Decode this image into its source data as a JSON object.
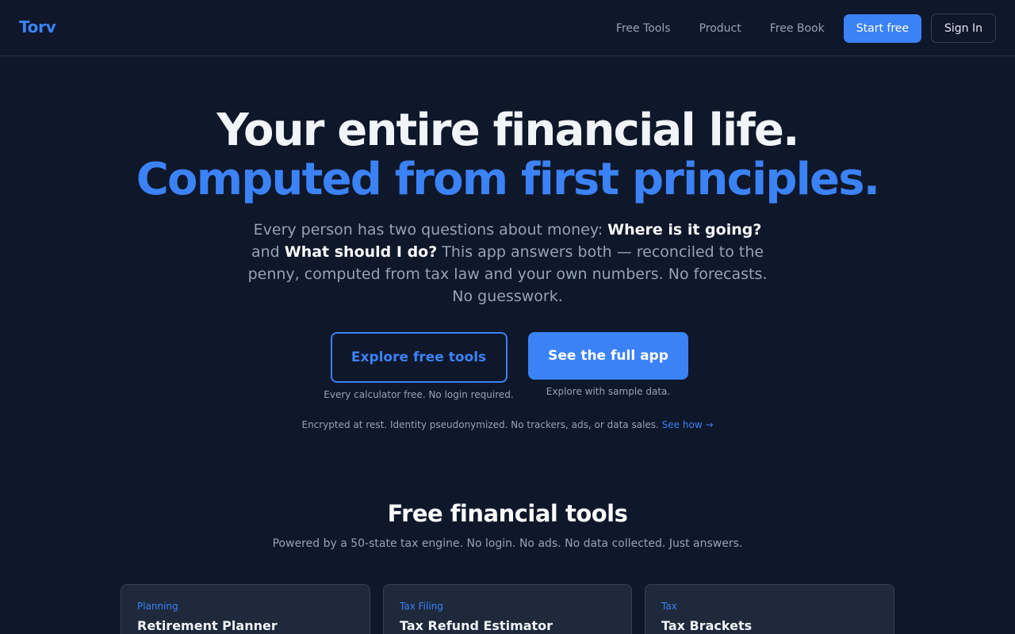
{
  "header": {
    "brand": "Torv",
    "nav": [
      "Free Tools",
      "Product",
      "Free Book"
    ],
    "start_label": "Start free",
    "signin_label": "Sign In"
  },
  "hero": {
    "title_line1": "Your entire financial life.",
    "title_line2": "Computed from first principles.",
    "sub_pre": "Every person has two questions about money: ",
    "sub_q1": "Where is it going?",
    "sub_and": " and ",
    "sub_q2": "What should I do?",
    "sub_post": " This app answers both — reconciled to the penny, computed from tax law and your own numbers. No forecasts. No guesswork.",
    "explore_label": "Explore free tools",
    "explore_note": "Every calculator free. No login required.",
    "full_label": "See the full app",
    "full_note": "Explore with sample data.",
    "privacy_text": "Encrypted at rest. Identity pseudonymized. No trackers, ads, or data sales. ",
    "privacy_link": "See how →"
  },
  "tools": {
    "title": "Free financial tools",
    "subtitle": "Powered by a 50-state tax engine. No login. No ads. No data collected. Just answers.",
    "cards": [
      {
        "category": "Planning",
        "name": "Retirement Planner"
      },
      {
        "category": "Tax Filing",
        "name": "Tax Refund Estimator"
      },
      {
        "category": "Tax",
        "name": "Tax Brackets"
      }
    ]
  },
  "colors": {
    "background": "#0f172a",
    "accent": "#3b82f6",
    "card": "#1e293b"
  }
}
